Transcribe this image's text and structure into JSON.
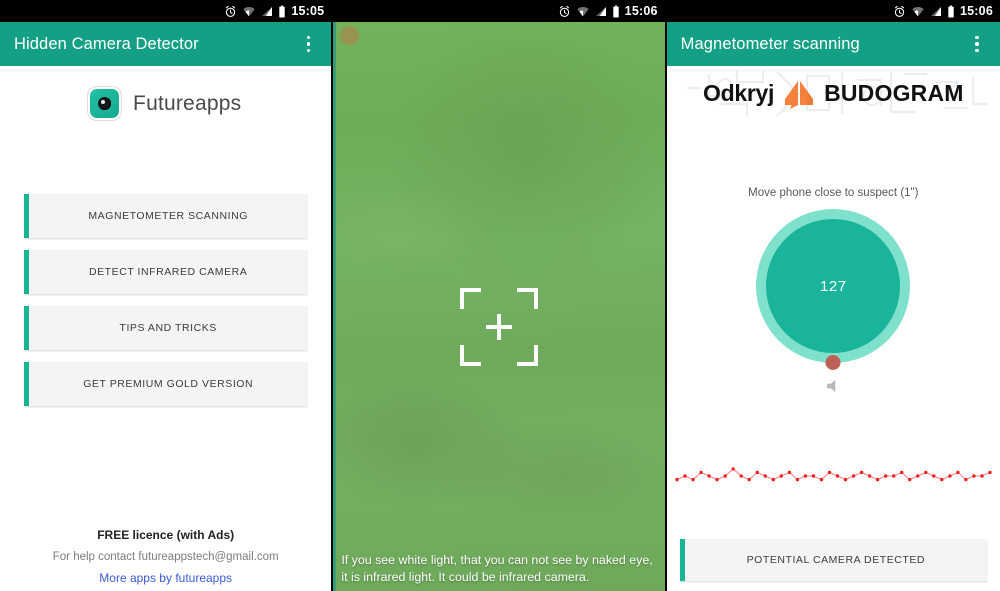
{
  "screens": [
    {
      "status_bar": {
        "time": "15:05",
        "icons": [
          "alarm-icon",
          "wifi-icon",
          "signal-icon",
          "battery-icon"
        ]
      },
      "appbar": {
        "title": "Hidden Camera Detector",
        "overflow_icon": "kebab-menu-icon"
      },
      "brand": {
        "icon": "camera-lens-app-icon",
        "name": "Futureapps"
      },
      "buttons": [
        {
          "label": "MAGNETOMETER SCANNING"
        },
        {
          "label": "DETECT INFRARED CAMERA"
        },
        {
          "label": "TIPS AND TRICKS"
        },
        {
          "label": "GET PREMIUM GOLD VERSION"
        }
      ],
      "footer": {
        "licence": "FREE licence (with Ads)",
        "contact": "For help contact futureappstech@gmail.com",
        "more_apps_link": "More apps by futureapps"
      }
    },
    {
      "status_bar": {
        "time": "15:06"
      },
      "camera": {
        "reticle_icon": "focus-reticle-icon",
        "lens_dot_icon": "lens-flare-dot-icon",
        "caption": "If you see white light, that you can not see by naked eye, it is infrared light. It could be infrared camera."
      }
    },
    {
      "status_bar": {
        "time": "15:06"
      },
      "appbar": {
        "title": "Magnetometer scanning",
        "overflow_icon": "kebab-menu-icon"
      },
      "ad": {
        "text_left": "Odkryj",
        "text_right": "BUDOGRAM",
        "logo_icon": "budogram-house-logo-icon"
      },
      "hint": "Move phone close to suspect (1\")",
      "gauge": {
        "value": "127",
        "marker_icon": "gauge-marker-dot-icon"
      },
      "speaker_icon": "speaker-mute-icon",
      "bottom_button": {
        "label": "POTENTIAL CAMERA DETECTED"
      }
    }
  ],
  "colors": {
    "teal_appbar": "#14a085",
    "teal_accent": "#1ab394",
    "gauge_outer": "#7fe0cb",
    "gauge_inner": "#19b49a",
    "gauge_marker": "#bf6058",
    "link_blue": "#3b5bd4",
    "ad_orange": "#f5813c",
    "graph_red": "#f02020"
  },
  "chart_data": {
    "type": "line",
    "title": "",
    "xlabel": "",
    "ylabel": "",
    "series": [
      {
        "name": "magnetic field",
        "values": [
          126,
          127,
          126,
          128,
          127,
          126,
          127,
          129,
          127,
          126,
          128,
          127,
          126,
          127,
          128,
          126,
          127,
          127,
          126,
          128,
          127,
          126,
          127,
          128,
          127,
          126,
          127,
          127,
          128,
          126,
          127,
          128,
          127,
          126,
          127,
          128,
          126,
          127,
          127,
          128
        ]
      }
    ],
    "ylim": [
      120,
      134
    ],
    "grid": false,
    "legend": "none",
    "marker_color": "#f02020"
  }
}
